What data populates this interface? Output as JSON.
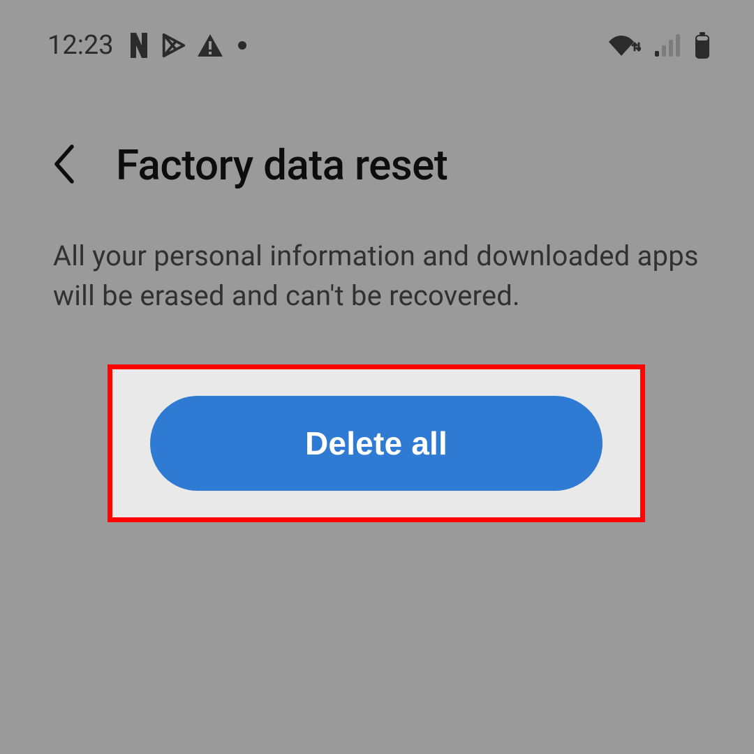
{
  "statusbar": {
    "time": "12:23"
  },
  "header": {
    "title": "Factory data reset"
  },
  "body": {
    "warning": "All your personal information and downloaded apps will be erased and can't be recovered."
  },
  "action": {
    "delete_label": "Delete all"
  }
}
